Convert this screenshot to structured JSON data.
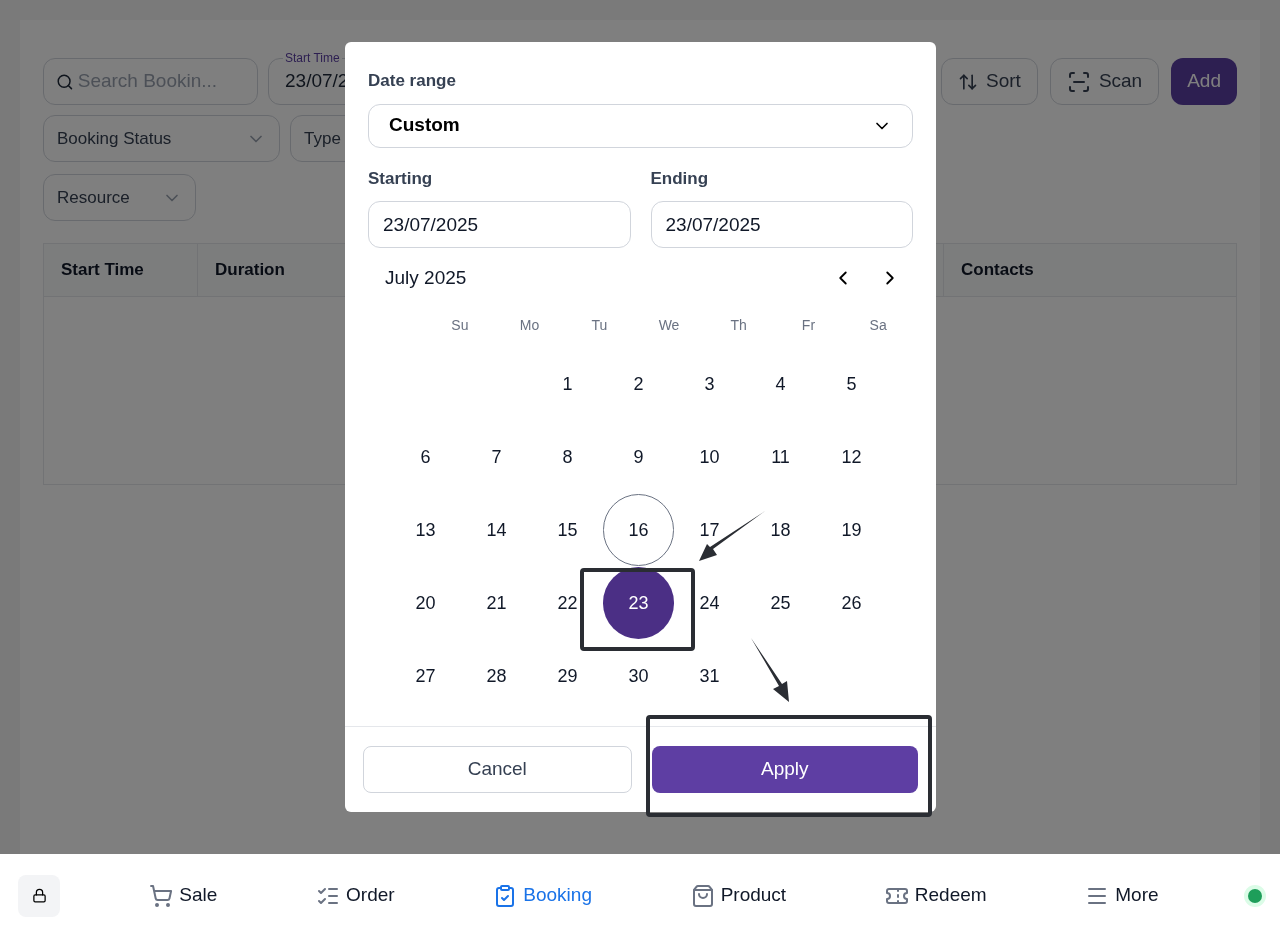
{
  "toolbar": {
    "search": {
      "placeholder": "Search Bookin..."
    },
    "start_time": {
      "label": "Start Time",
      "value": "23/07/2"
    },
    "buttons": [
      {
        "kind": "sort",
        "label": "Sort"
      },
      {
        "kind": "scan",
        "label": "Scan"
      },
      {
        "kind": "add",
        "label": "Add"
      }
    ]
  },
  "filters": [
    {
      "label": "Booking Status"
    },
    {
      "label": "Type"
    },
    {
      "label": "Resource"
    }
  ],
  "table": {
    "columns": [
      "Start Time",
      "Duration",
      "Contacts"
    ]
  },
  "dialog": {
    "date_range_label": "Date range",
    "date_range_value": "Custom",
    "starting_label": "Starting",
    "starting_value": "23/07/2025",
    "ending_label": "Ending",
    "ending_value": "23/07/2025",
    "month": "July 2025",
    "weekdays": [
      "Su",
      "Mo",
      "Tu",
      "We",
      "Th",
      "Fr",
      "Sa"
    ],
    "weeks": [
      [
        {
          "day": "1",
          "selected": false,
          "today": false
        },
        {
          "day": "2",
          "selected": false,
          "today": false
        },
        {
          "day": "3",
          "selected": false,
          "today": false
        },
        {
          "day": "4",
          "selected": false,
          "today": false
        },
        {
          "day": "5",
          "selected": false,
          "today": false
        }
      ],
      [
        {
          "day": "6",
          "selected": false,
          "today": false
        },
        {
          "day": "7",
          "selected": false,
          "today": false
        },
        {
          "day": "8",
          "selected": false,
          "today": false
        },
        {
          "day": "9",
          "selected": false,
          "today": false
        },
        {
          "day": "10",
          "selected": false,
          "today": false
        },
        {
          "day": "11",
          "selected": false,
          "today": false
        },
        {
          "day": "12",
          "selected": false,
          "today": false
        }
      ],
      [
        {
          "day": "13",
          "selected": false,
          "today": false
        },
        {
          "day": "14",
          "selected": false,
          "today": false
        },
        {
          "day": "15",
          "selected": false,
          "today": false
        },
        {
          "day": "16",
          "selected": false,
          "today": true
        },
        {
          "day": "17",
          "selected": false,
          "today": false
        },
        {
          "day": "18",
          "selected": false,
          "today": false
        },
        {
          "day": "19",
          "selected": false,
          "today": false
        }
      ],
      [
        {
          "day": "20",
          "selected": false,
          "today": false
        },
        {
          "day": "21",
          "selected": false,
          "today": false
        },
        {
          "day": "22",
          "selected": false,
          "today": false
        },
        {
          "day": "23",
          "selected": true,
          "today": false
        },
        {
          "day": "24",
          "selected": false,
          "today": false
        },
        {
          "day": "25",
          "selected": false,
          "today": false
        },
        {
          "day": "26",
          "selected": false,
          "today": false
        }
      ],
      [
        {
          "day": "27",
          "selected": false,
          "today": false
        },
        {
          "day": "28",
          "selected": false,
          "today": false
        },
        {
          "day": "29",
          "selected": false,
          "today": false
        },
        {
          "day": "30",
          "selected": false,
          "today": false
        },
        {
          "day": "31",
          "selected": false,
          "today": false
        }
      ]
    ],
    "cancel": "Cancel",
    "apply": "Apply"
  },
  "nav": {
    "items": [
      {
        "kind": "sale",
        "label": "Sale",
        "selected": false
      },
      {
        "kind": "order",
        "label": "Order",
        "selected": false
      },
      {
        "kind": "booking",
        "label": "Booking",
        "selected": true
      },
      {
        "kind": "product",
        "label": "Product",
        "selected": false
      },
      {
        "kind": "redeem",
        "label": "Redeem",
        "selected": false
      },
      {
        "kind": "more",
        "label": "More",
        "selected": false
      }
    ],
    "online": true
  }
}
